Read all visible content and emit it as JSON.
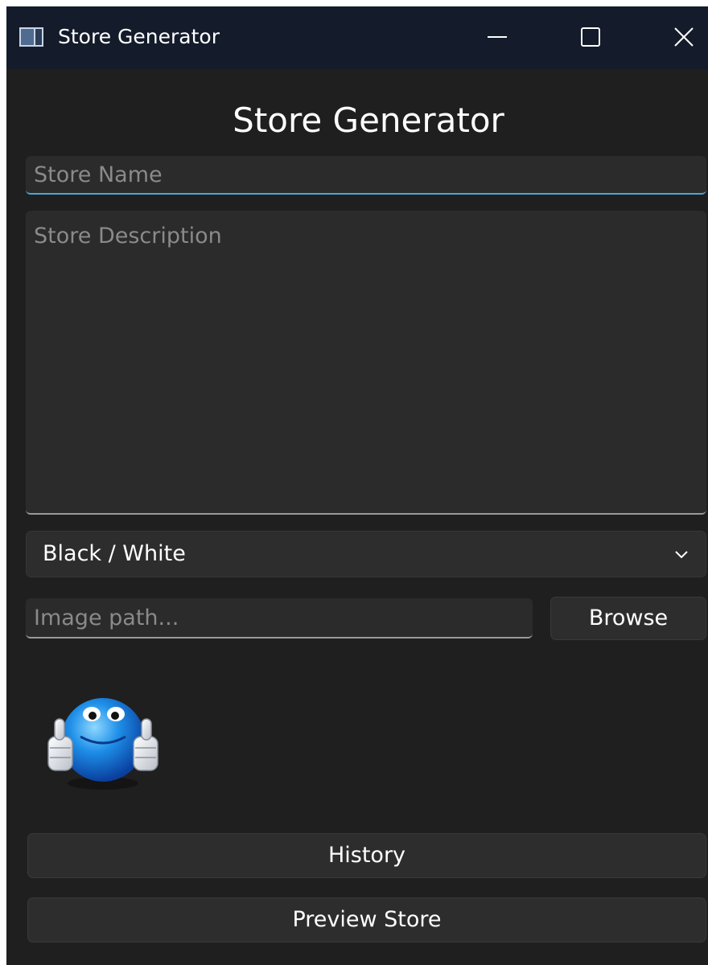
{
  "window": {
    "title": "Store Generator"
  },
  "heading": "Store Generator",
  "form": {
    "store_name_placeholder": "Store Name",
    "store_name_value": "",
    "store_description_placeholder": "Store Description",
    "store_description_value": "",
    "color_scheme_selected": "Black / White",
    "image_path_placeholder": "Image path...",
    "image_path_value": "",
    "browse_label": "Browse"
  },
  "preview_image": {
    "icon": "blue-smiley-thumbs-up"
  },
  "actions": {
    "history_label": "History",
    "preview_label": "Preview Store"
  },
  "colors": {
    "window_bg": "#1f1f1f",
    "titlebar_bg": "#141b2b",
    "accent": "#4aa8d8",
    "field_bg": "#2b2b2b",
    "button_bg": "#2d2d2d"
  }
}
